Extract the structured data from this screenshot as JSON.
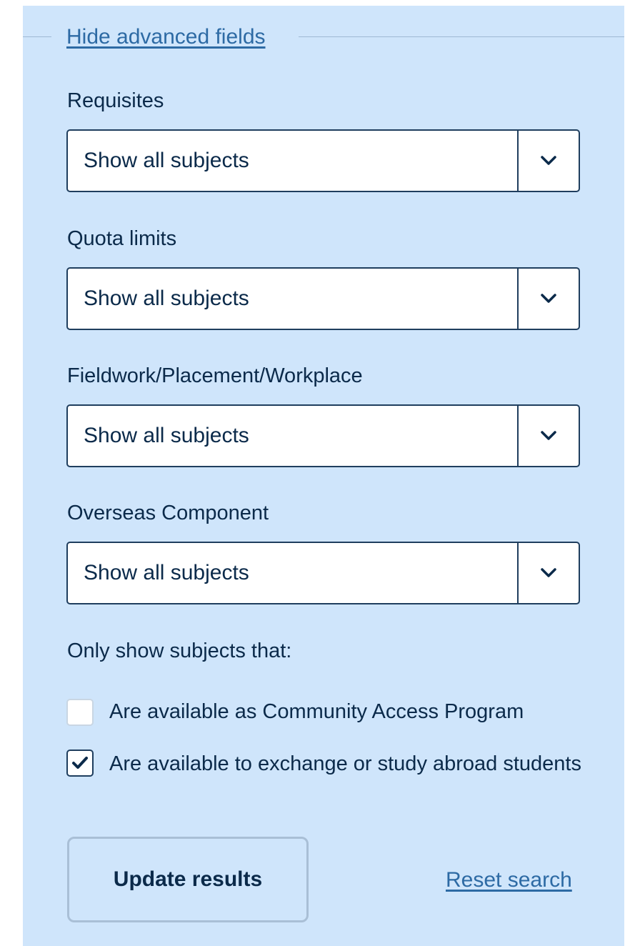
{
  "advanced": {
    "toggle_label": "Hide advanced fields"
  },
  "filters": [
    {
      "label": "Requisites",
      "value": "Show all subjects"
    },
    {
      "label": "Quota limits",
      "value": "Show all subjects"
    },
    {
      "label": "Fieldwork/Placement/Workplace",
      "value": "Show all subjects"
    },
    {
      "label": "Overseas Component",
      "value": "Show all subjects"
    }
  ],
  "only_show": {
    "heading": "Only show subjects that:",
    "options": [
      {
        "label": "Are available as Community Access Program",
        "checked": false
      },
      {
        "label": "Are available to exchange or study abroad students",
        "checked": true
      }
    ]
  },
  "actions": {
    "update_label": "Update results",
    "reset_label": "Reset search"
  },
  "colors": {
    "panel": "#cfe5fb",
    "link": "#2d6aa4",
    "text": "#0b2a4a",
    "border": "#1f3e5e"
  }
}
